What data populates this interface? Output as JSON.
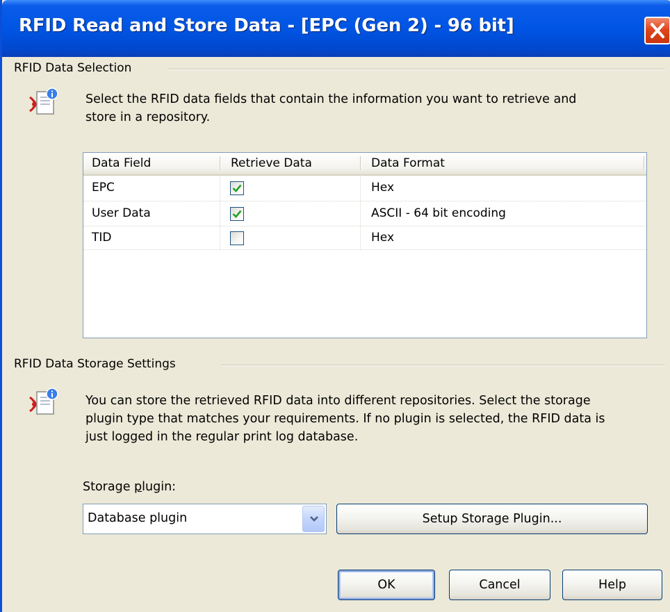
{
  "window": {
    "title": "RFID Read and Store Data - [EPC (Gen 2) - 96 bit]",
    "close_icon": "close-icon"
  },
  "selection": {
    "group_label": "RFID Data Selection",
    "icon": "rfid-info-icon",
    "description_line1": "Select the RFID data fields that contain the information you want to retrieve and",
    "description_line2": "store in a repository.",
    "columns": [
      "Data Field",
      "Retrieve Data",
      "Data Format"
    ],
    "rows": [
      {
        "field": "EPC",
        "retrieve": true,
        "format": "Hex"
      },
      {
        "field": "User Data",
        "retrieve": true,
        "format": "ASCII - 64 bit encoding"
      },
      {
        "field": "TID",
        "retrieve": false,
        "format": "Hex"
      }
    ]
  },
  "storage": {
    "group_label": "RFID Data Storage Settings",
    "icon": "rfid-info-icon",
    "description_line1": "You can store the retrieved RFID data into different repositories. Select the storage",
    "description_line2": "plugin type that matches your requirements. If no plugin is selected, the RFID data is",
    "description_line3": "just logged in the regular print log database.",
    "plugin_label_prefix": "Storage ",
    "plugin_label_accel": "p",
    "plugin_label_suffix": "lugin:",
    "plugin_value": "Database plugin",
    "setup_button": "Setup Storage Plugin..."
  },
  "buttons": {
    "ok": "OK",
    "cancel": "Cancel",
    "help": "Help"
  },
  "colors": {
    "titlebar": "#0055e5",
    "dialog_bg": "#ece9d8",
    "check": "#21a121",
    "close": "#e0461e"
  }
}
